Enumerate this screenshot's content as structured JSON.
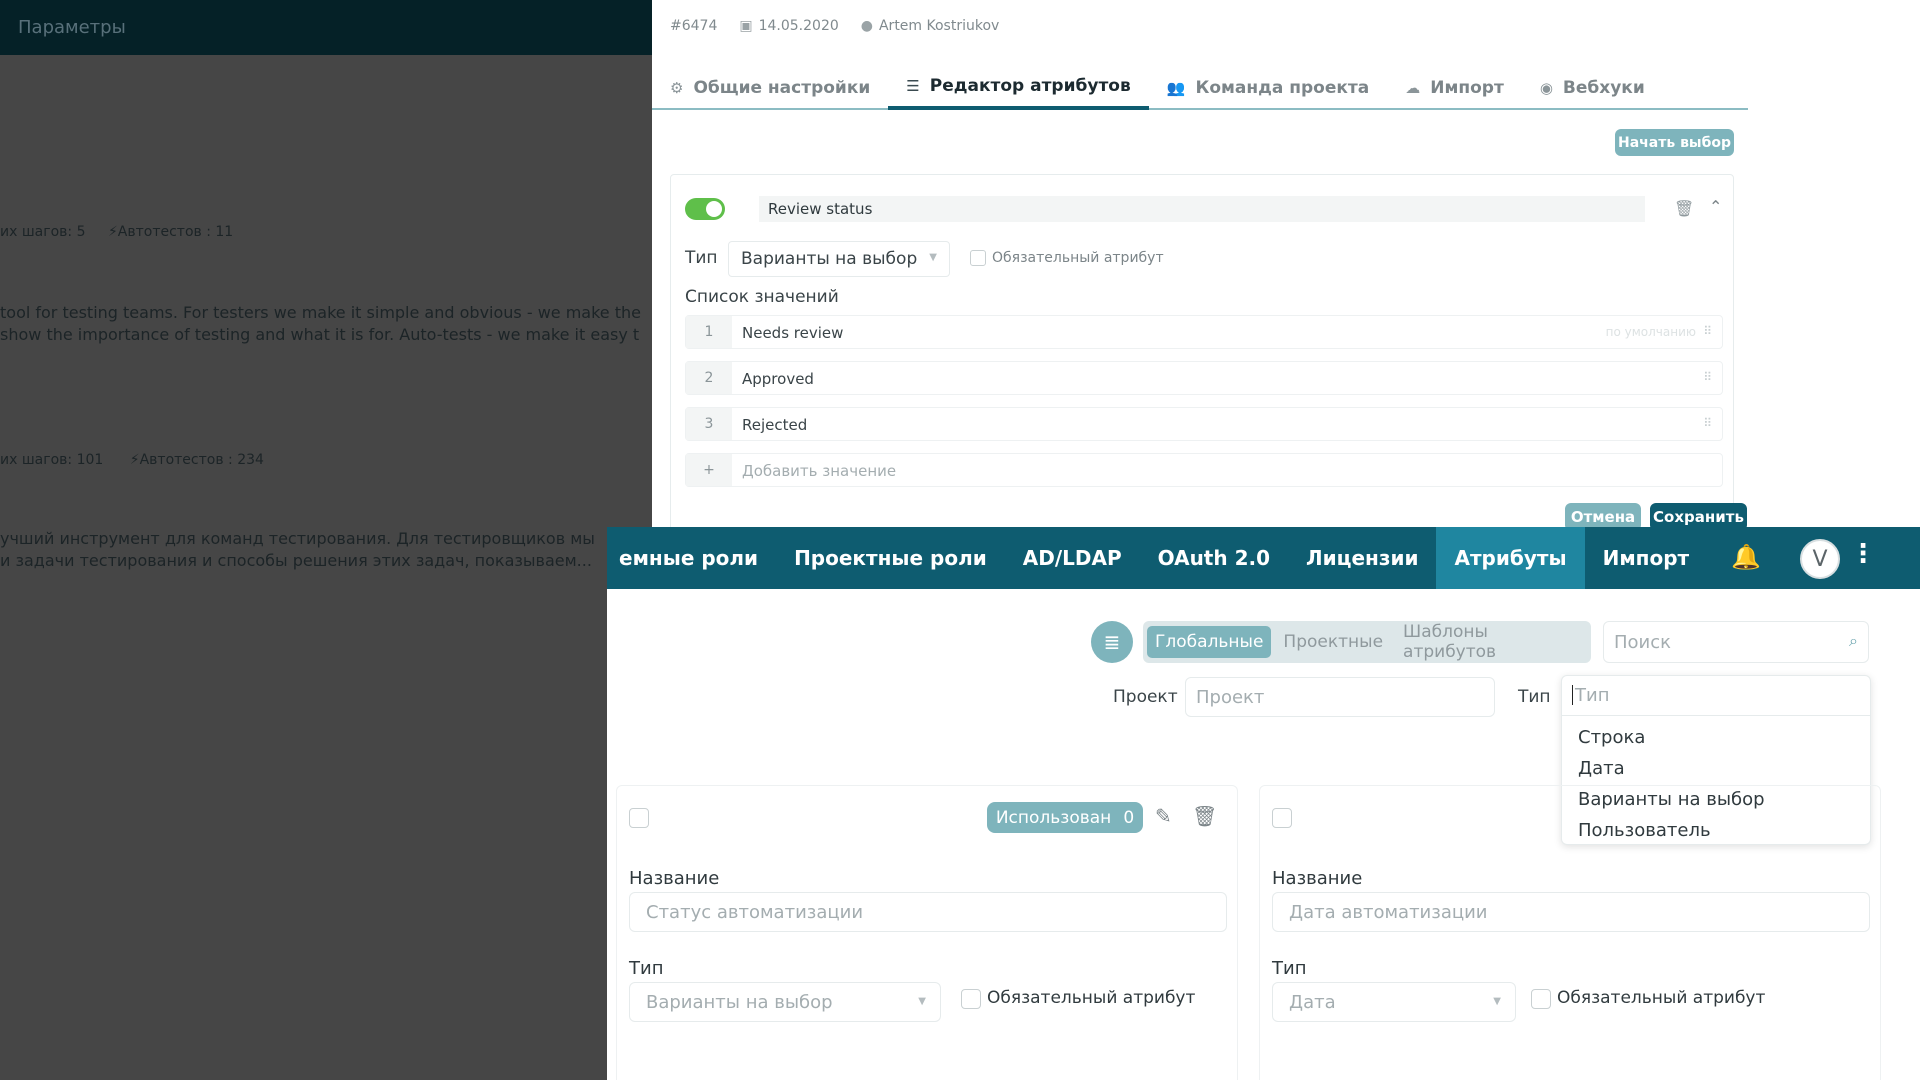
{
  "backdrop": {
    "title": "Параметры",
    "project1": {
      "steps": "их шагов: 5",
      "autotests": "Автотестов : 11",
      "desc_line1": " tool for testing teams. For testers we make it simple and obvious - we make the",
      "desc_line2": " show the importance of testing and what it is for. Auto-tests - we make it easy t"
    },
    "project2": {
      "steps": "их шагов: 101",
      "autotests": "Автотестов : 234",
      "desc_line1": "учший инструмент для команд тестирования. Для тестировщиков мы",
      "desc_line2": "и задачи тестирования и способы решения этих задач, показываем..."
    }
  },
  "project": {
    "id": "#6474",
    "date": "14.05.2020",
    "author": "Artem Kostriukov",
    "tabs": [
      {
        "label": "Общие настройки",
        "icon": "gear-icon"
      },
      {
        "label": "Редактор атрибутов",
        "icon": "filter-icon",
        "active": true
      },
      {
        "label": "Команда проекта",
        "icon": "team-icon"
      },
      {
        "label": "Импорт",
        "icon": "cloud-icon"
      },
      {
        "label": "Вебхуки",
        "icon": "broadcast-icon"
      }
    ],
    "start_select_label": "Начать выбор",
    "attribute": {
      "enabled": true,
      "name": "Review status",
      "type_label": "Тип",
      "type_value": "Варианты на выбор",
      "required_label": "Обязательный атрибут",
      "values_title": "Список значений",
      "values": [
        {
          "num": "1",
          "text": "Needs review",
          "default_label": "по умолчанию"
        },
        {
          "num": "2",
          "text": "Approved"
        },
        {
          "num": "3",
          "text": "Rejected"
        }
      ],
      "add_value_label": "Добавить значение",
      "cancel_label": "Отмена",
      "save_label": "Сохранить"
    }
  },
  "admin": {
    "nav": [
      "емные роли",
      "Проектные роли",
      "AD/LDAP",
      "OAuth 2.0",
      "Лицензии",
      "Атрибуты",
      "Импорт"
    ],
    "nav_active": "Атрибуты",
    "avatar_letter": "V",
    "segments": [
      "Глобальные",
      "Проектные",
      "Шаблоны атрибутов"
    ],
    "segment_active": "Глобальные",
    "search_placeholder": "Поиск",
    "filter_project_label": "Проект",
    "filter_project_placeholder": "Проект",
    "filter_type_label": "Тип",
    "filter_type_placeholder": "Тип",
    "type_options": [
      "Строка",
      "Дата",
      "Варианты на выбор",
      "Пользователь"
    ],
    "cards": [
      {
        "used_label": "Использован",
        "used_count": "0",
        "name_label": "Название",
        "name_placeholder": "Статус автоматизации",
        "type_label": "Тип",
        "type_value": "Варианты на выбор",
        "required_label": "Обязательный атрибут"
      },
      {
        "name_label": "Название",
        "name_placeholder": "Дата автоматизации",
        "type_label": "Тип",
        "type_value": "Дата",
        "required_label": "Обязательный атрибут"
      }
    ]
  },
  "colors": {
    "brand": "#0e5c70",
    "accent": "#7eb4bc",
    "nav_active": "#1f86a0",
    "toggle_on": "#5fbf4a"
  }
}
